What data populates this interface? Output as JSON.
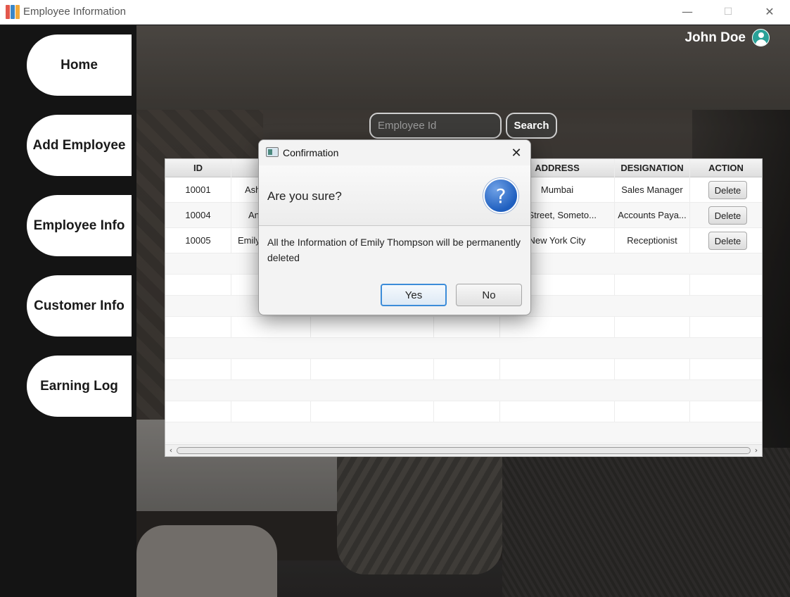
{
  "window": {
    "title": "Employee Information",
    "icon": "app-books-icon",
    "controls": {
      "minimize": "—",
      "maximize": "☐",
      "close": "✕"
    }
  },
  "sidebar": {
    "items": [
      {
        "label": "Home"
      },
      {
        "label": "Add Employee"
      },
      {
        "label": "Employee Info"
      },
      {
        "label": "Customer Info"
      },
      {
        "label": "Earning Log"
      }
    ]
  },
  "header": {
    "user_name": "John Doe",
    "avatar_icon": "user-avatar-icon"
  },
  "search": {
    "placeholder": "Employee Id",
    "button_label": "Search"
  },
  "table": {
    "columns": [
      "ID",
      "",
      "",
      "",
      "ADDRESS",
      "DESIGNATION",
      "ACTION"
    ],
    "rows": [
      {
        "id": "10001",
        "name": "Ash",
        "address": "Mumbai",
        "designation": "Sales Manager",
        "action": "Delete"
      },
      {
        "id": "10004",
        "name": "An",
        "address": "m Street, Someto...",
        "designation": "Accounts Paya...",
        "action": "Delete"
      },
      {
        "id": "10005",
        "name": "Emily",
        "address": "New York City",
        "designation": "Receptionist",
        "action": "Delete"
      }
    ]
  },
  "dialog": {
    "title": "Confirmation",
    "close": "✕",
    "question": "Are you sure?",
    "question_icon": "?",
    "message": "All the Information of Emily Thompson will be permanently deleted",
    "yes_label": "Yes",
    "no_label": "No"
  },
  "colors": {
    "sidebar_bg": "#141414",
    "accent_avatar": "#2aa198",
    "default_button_border": "#3c8cd9"
  }
}
